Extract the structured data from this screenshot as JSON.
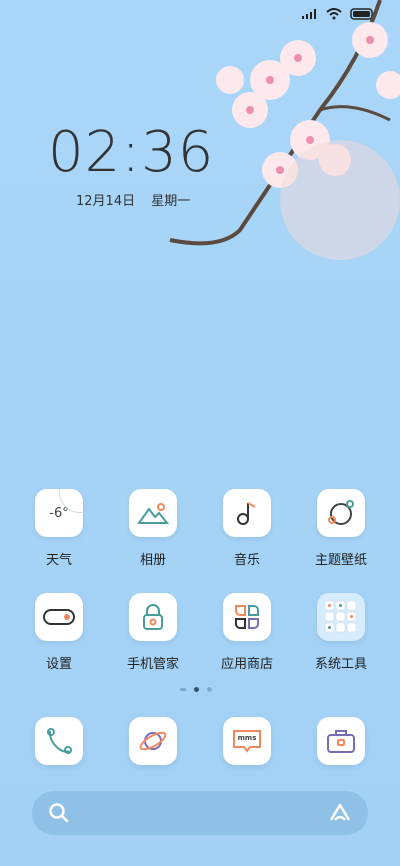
{
  "lockscreen": {
    "time": "02:36",
    "date": "12月14日",
    "weekday": "星期一"
  },
  "weather": {
    "temp": "-6°"
  },
  "apps": [
    {
      "label": "天气",
      "icon": "weather-icon"
    },
    {
      "label": "相册",
      "icon": "gallery-icon"
    },
    {
      "label": "音乐",
      "icon": "music-note-icon"
    },
    {
      "label": "主题壁纸",
      "icon": "themes-icon"
    },
    {
      "label": "设置",
      "icon": "settings-toggle-icon"
    },
    {
      "label": "手机管家",
      "icon": "security-lock-icon"
    },
    {
      "label": "应用商店",
      "icon": "app-store-icon"
    },
    {
      "label": "系统工具",
      "icon": "folder-icon"
    }
  ],
  "dock": [
    {
      "icon": "phone-icon"
    },
    {
      "icon": "browser-planet-icon"
    },
    {
      "icon": "messages-icon",
      "text": "mms"
    },
    {
      "icon": "toolbox-icon"
    }
  ],
  "colors": {
    "accent_orange": "#f08a5d",
    "accent_teal": "#4a9b9b",
    "background": "#a6d4f7"
  }
}
